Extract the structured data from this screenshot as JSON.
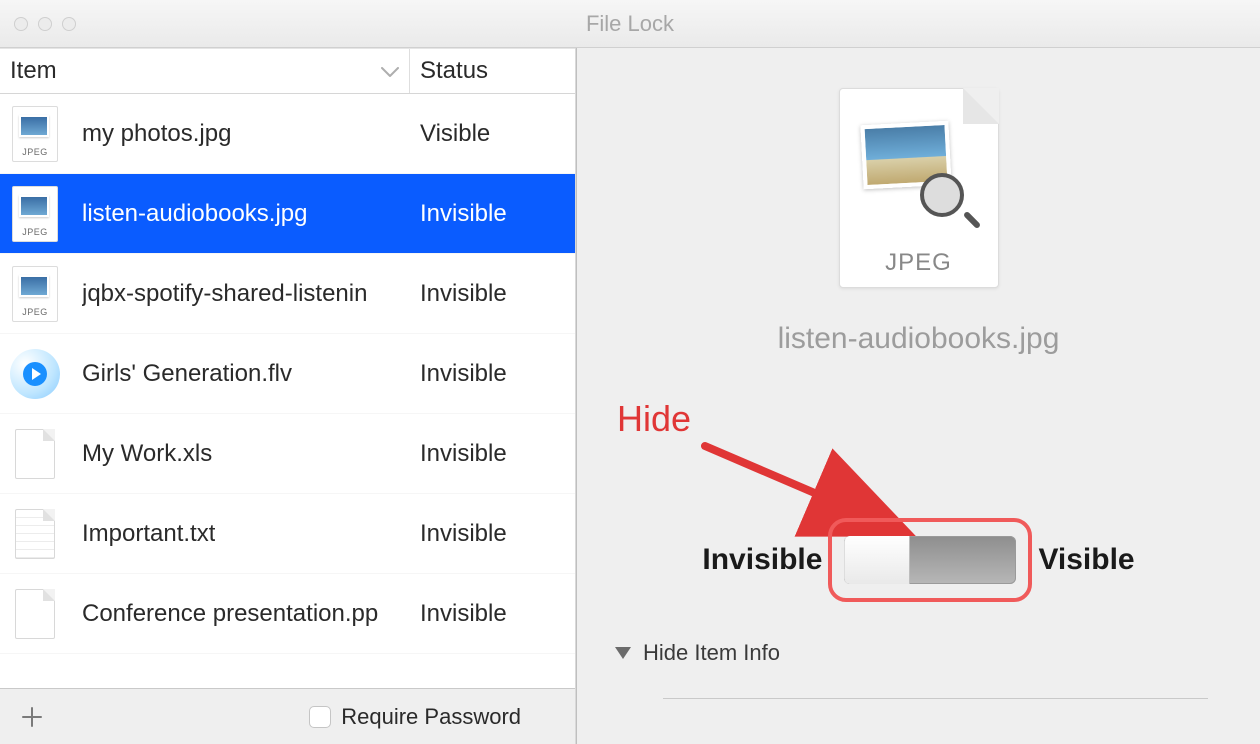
{
  "window": {
    "title": "File Lock"
  },
  "table": {
    "headers": {
      "item": "Item",
      "status": "Status"
    },
    "rows": [
      {
        "name": "my photos.jpg",
        "status": "Visible",
        "icon": "jpeg",
        "selected": false
      },
      {
        "name": "listen-audiobooks.jpg",
        "status": "Invisible",
        "icon": "jpeg",
        "selected": true
      },
      {
        "name": "jqbx-spotify-shared-listenin",
        "status": "Invisible",
        "icon": "jpeg",
        "selected": false
      },
      {
        "name": "Girls' Generation.flv",
        "status": "Invisible",
        "icon": "flv",
        "selected": false
      },
      {
        "name": "My Work.xls",
        "status": "Invisible",
        "icon": "doc",
        "selected": false
      },
      {
        "name": "Important.txt",
        "status": "Invisible",
        "icon": "txt",
        "selected": false
      },
      {
        "name": "Conference presentation.pp",
        "status": "Invisible",
        "icon": "doc",
        "selected": false
      }
    ]
  },
  "footer": {
    "require_password_label": "Require Password",
    "require_password_checked": false
  },
  "preview": {
    "ext_label": "JPEG",
    "filename": "listen-audiobooks.jpg",
    "invisible_label": "Invisible",
    "visible_label": "Visible",
    "toggle_state": "invisible",
    "hide_item_info_label": "Hide Item Info"
  },
  "annotation": {
    "text": "Hide"
  }
}
